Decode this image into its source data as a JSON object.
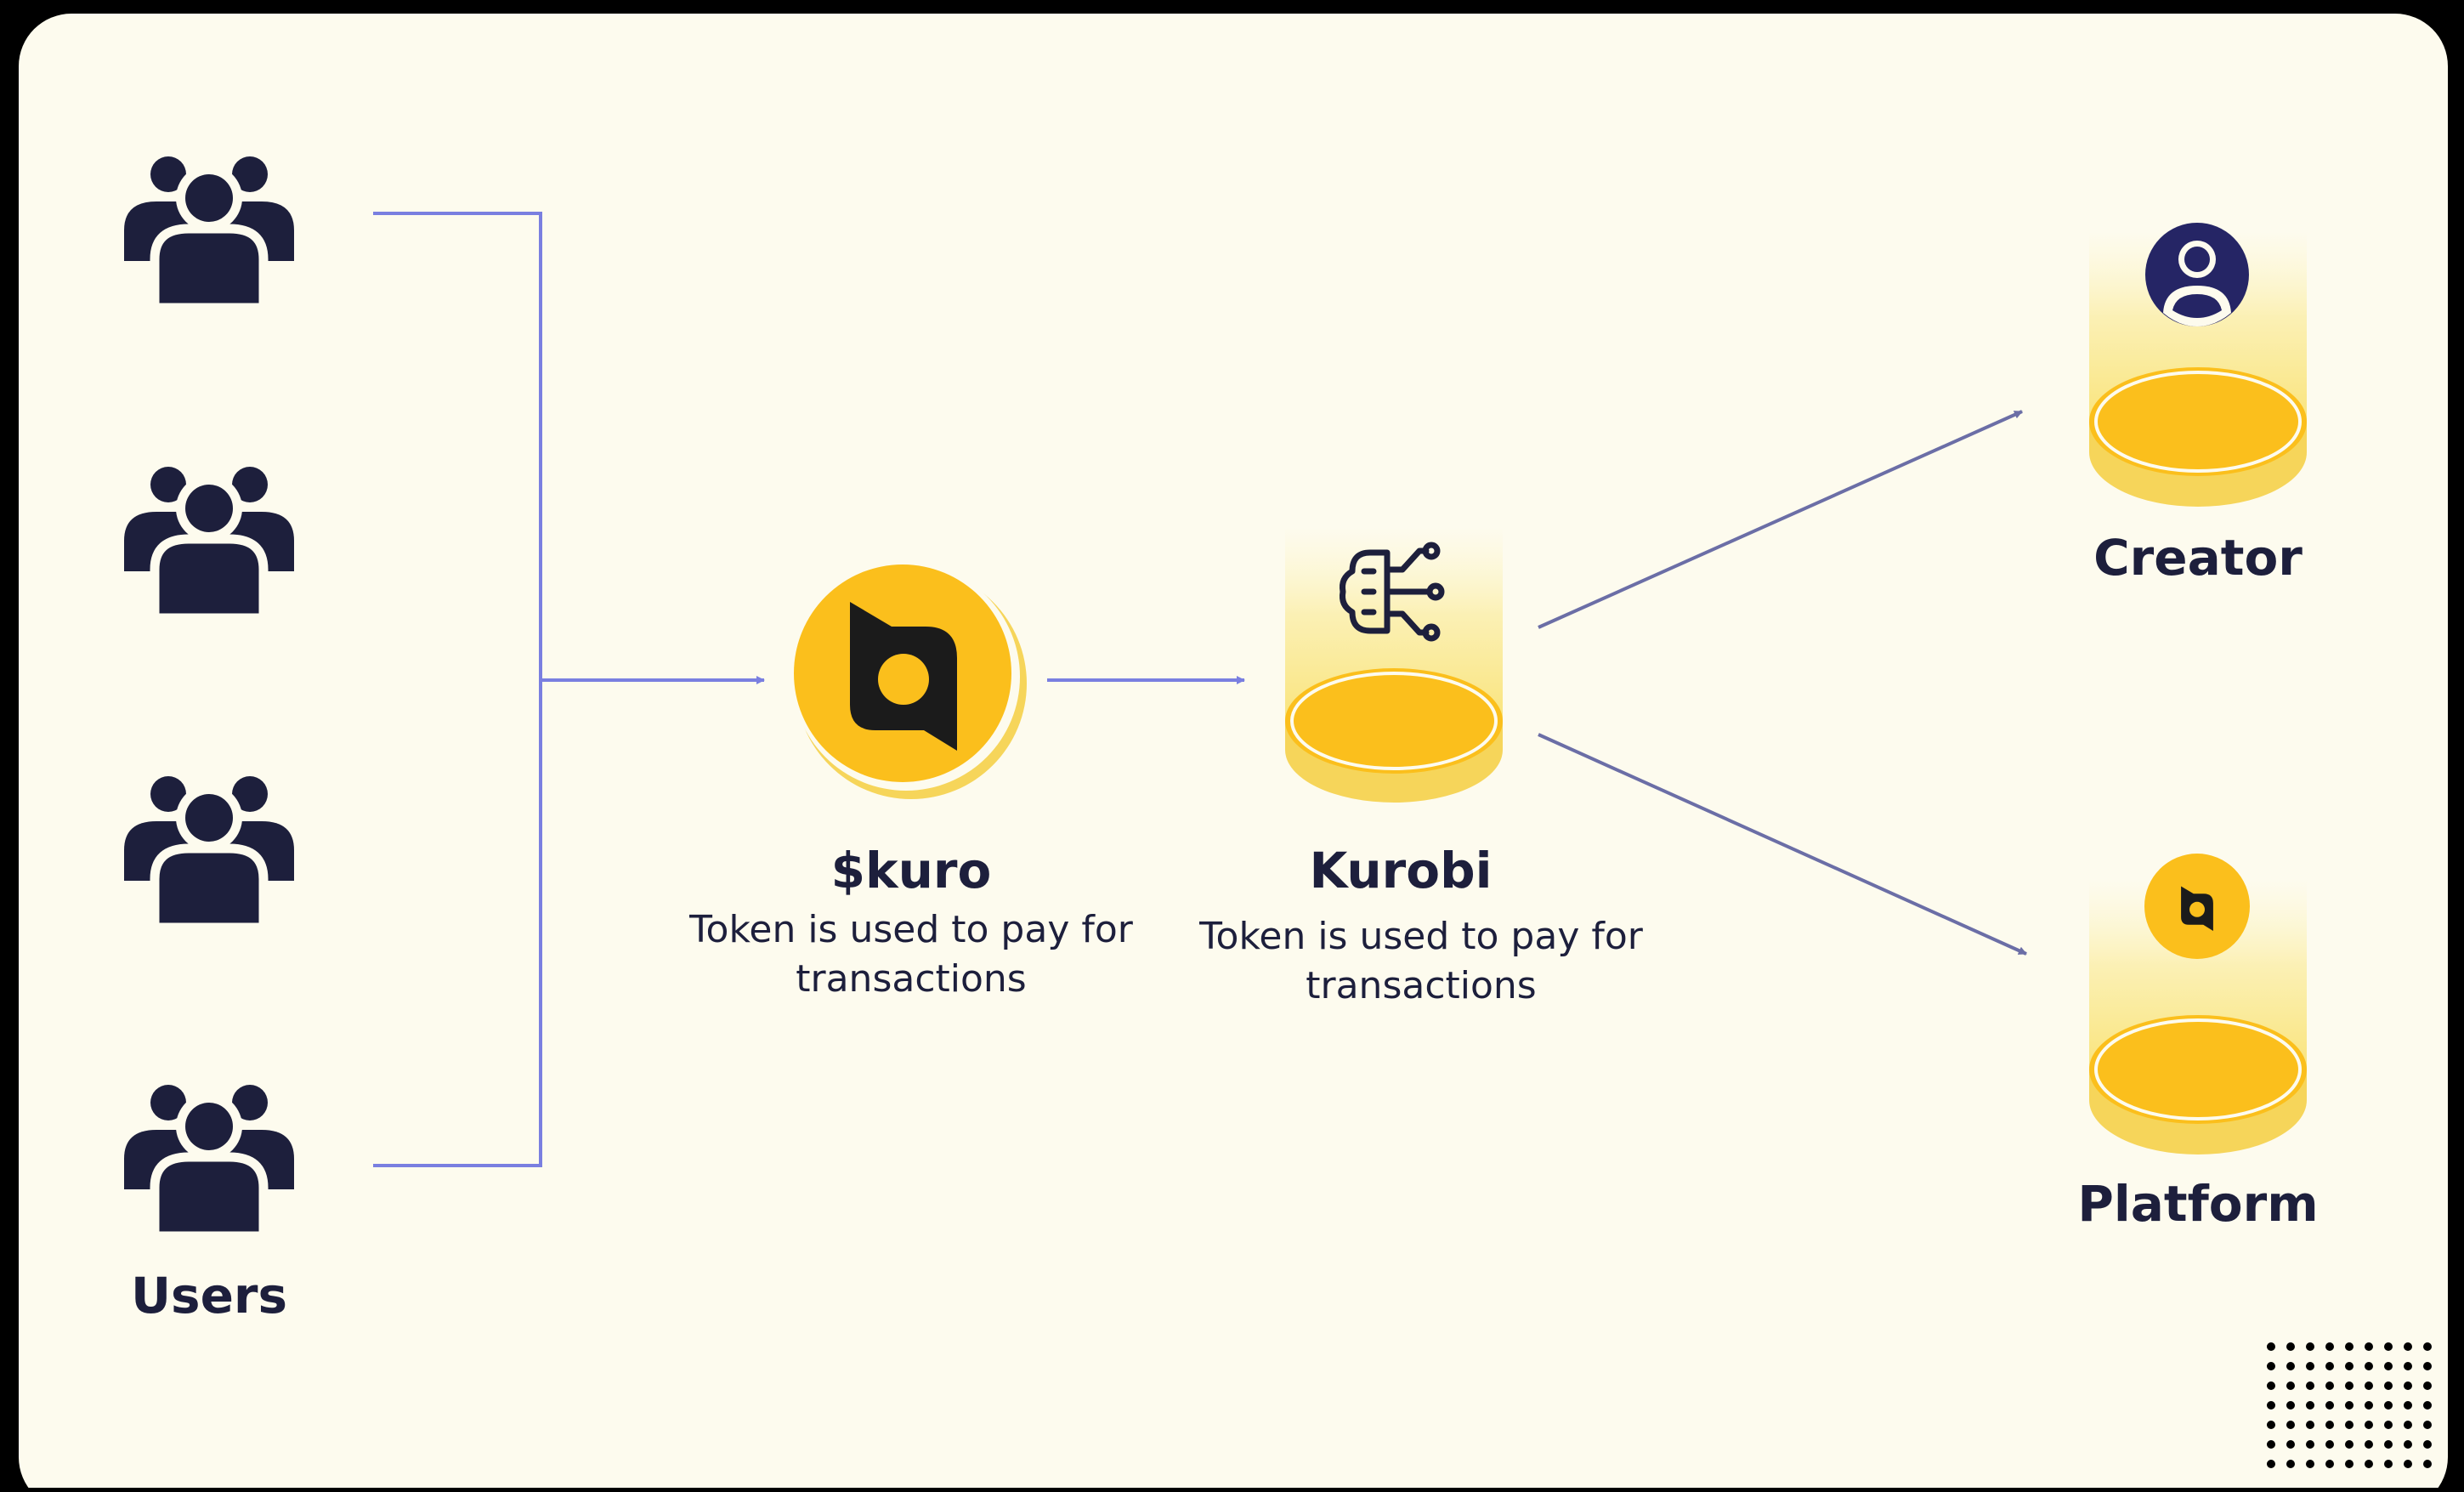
{
  "colors": {
    "background": "#000000",
    "card": "#fdfbee",
    "icon_dark": "#1d1f3c",
    "connector_blue": "#7a7fe0",
    "connector_slate": "#6b6ea6",
    "coin_gold": "#fbbf1c",
    "coin_rim": "#f6d55a",
    "creator_avatar": "#252565"
  },
  "icons": {
    "users": "users-group-icon",
    "token": "kuro-logo-icon",
    "kurobi": "brain-circuit-icon",
    "creator": "user-avatar-icon",
    "platform": "kuro-logo-icon"
  },
  "nodes": {
    "users": {
      "title": "Users"
    },
    "token": {
      "title": "$kuro",
      "desc_line1": "Token is used to pay for",
      "desc_line2": "transactions"
    },
    "kurobi": {
      "title": "Kurobi",
      "desc_line1": "Token is used to pay for",
      "desc_line2": "transactions"
    },
    "creator": {
      "title": "Creator"
    },
    "platform": {
      "title": "Platform"
    }
  },
  "edges": [
    {
      "from": "users",
      "to": "token"
    },
    {
      "from": "token",
      "to": "kurobi"
    },
    {
      "from": "kurobi",
      "to": "creator"
    },
    {
      "from": "kurobi",
      "to": "platform"
    }
  ]
}
